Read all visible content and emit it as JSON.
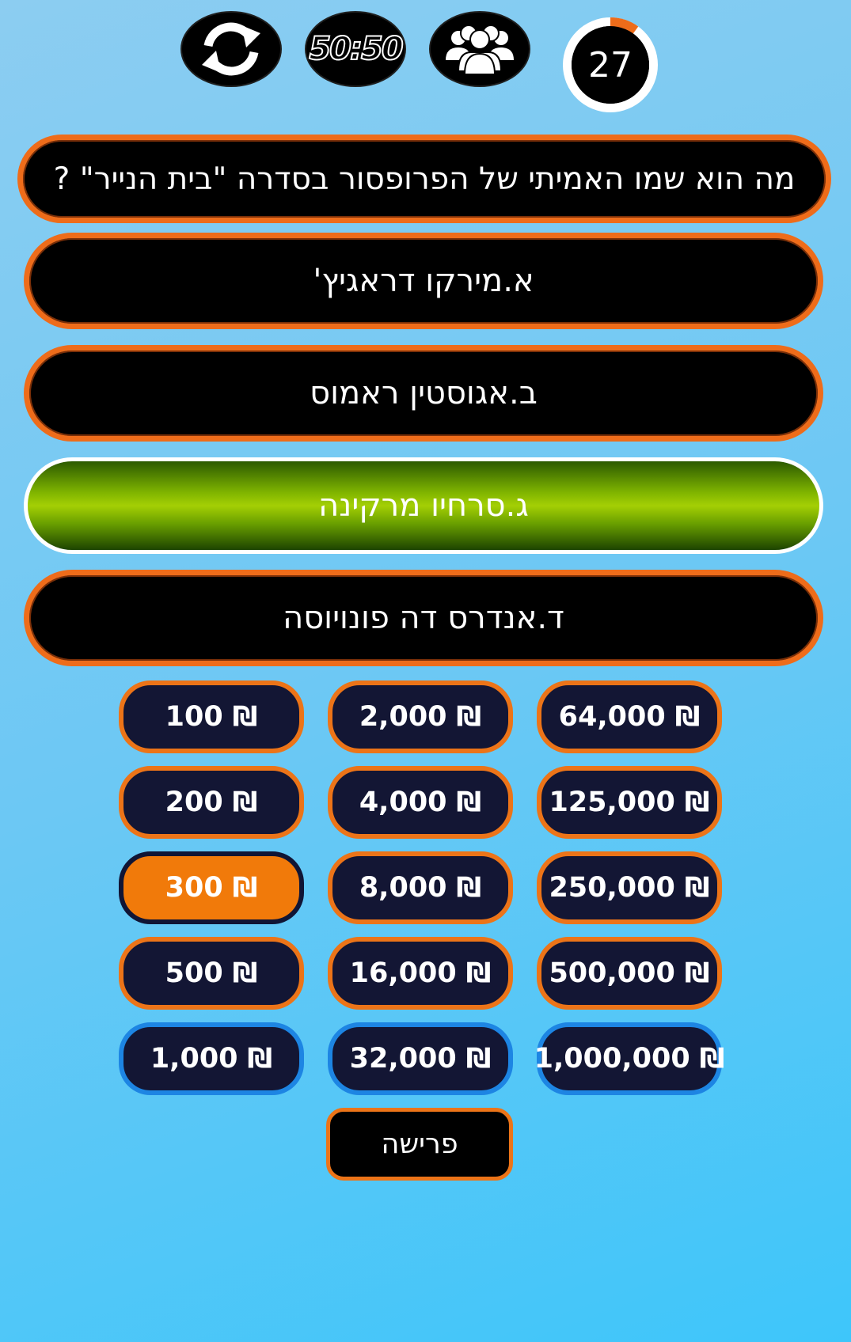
{
  "lifelines": {
    "swap_icon": "refresh-cycle-icon",
    "fifty_fifty_label": "50:50",
    "audience_icon": "group-people-icon"
  },
  "timer": {
    "seconds": "27",
    "ring_color": "#ee6c1a",
    "elapsed_fraction": 0.1
  },
  "question": "מה הוא שמו האמיתי של הפרופסור בסדרה \"בית הנייר\" ?",
  "answers": [
    {
      "id": "a",
      "text": "א.מירקו דראגיץ'"
    },
    {
      "id": "b",
      "text": "ב.אגוסטין ראמוס"
    },
    {
      "id": "c",
      "text": "ג.סרחיו מרקינה",
      "state": "selected"
    },
    {
      "id": "d",
      "text": "ד.אנדרס דה פונויוסה"
    }
  ],
  "prizes": {
    "currency_symbol": "₪",
    "col1": [
      "100",
      "200",
      "300",
      "500",
      "1,000"
    ],
    "col2": [
      "2,000",
      "4,000",
      "8,000",
      "16,000",
      "32,000"
    ],
    "col3": [
      "64,000",
      "125,000",
      "250,000",
      "500,000",
      "1,000,000"
    ],
    "current": "300",
    "milestones": [
      "1,000",
      "32,000",
      "1,000,000"
    ]
  },
  "quit_label": "פרישה",
  "colors": {
    "accent_orange": "#ee6c1a",
    "milestone_blue": "#1d85e3",
    "prize_bg": "#131634",
    "selected_green": "#a4cf04"
  }
}
